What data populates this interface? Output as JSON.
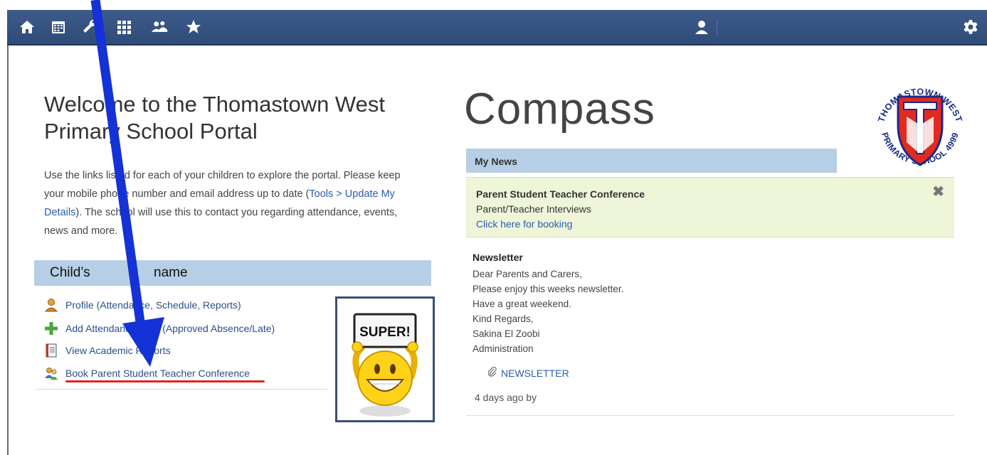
{
  "nav": {
    "icons": [
      "home-icon",
      "calendar-icon",
      "tools-icon",
      "grid-icon",
      "people-icon",
      "star-icon",
      "user-icon",
      "gear-icon"
    ]
  },
  "welcome": {
    "title": "Welcome to the Thomastown West Primary School Portal",
    "text_a": "Use the links listed for each of your children to explore the portal. Please keep your mobile phone number and email address up to date (",
    "text_link": "Tools > Update My Details",
    "text_b": "). The school will use this to contact you regarding attendance, events, news and more."
  },
  "child": {
    "header_left": "Child’s",
    "header_right": "name",
    "links": [
      {
        "label": "Profile (Attendance, Schedule, Reports)",
        "icon": "profile-icon"
      },
      {
        "label": "Add Attendance Note (Approved Absence/Late)",
        "icon": "plus-icon"
      },
      {
        "label": "View Academic Reports",
        "icon": "report-icon"
      },
      {
        "label": "Book Parent Student Teacher Conference",
        "icon": "conference-icon"
      }
    ]
  },
  "super": {
    "sign": "SUPER!"
  },
  "compass": {
    "title": "Compass"
  },
  "logo": {
    "top_text": "THOMASTOWN WEST",
    "bottom_text": "PRIMARY SCHOOL 4999"
  },
  "news": {
    "header": "My News",
    "conference": {
      "title": "Parent Student Teacher Conference",
      "subtitle": "Parent/Teacher Interviews",
      "link": "Click here for booking",
      "close": "✖"
    },
    "newsletter": {
      "title": "Newsletter",
      "lines": [
        "Dear Parents and Carers,",
        "Please enjoy this weeks newsletter.",
        "Have a great weekend.",
        "Kind Regards,",
        "Sakina El Zoobi",
        "Administration"
      ],
      "attachment": "NEWSLETTER",
      "meta": "4 days ago by"
    }
  },
  "colors": {
    "nav_bg": "#2f4b78",
    "header_bg": "#b6cfe6",
    "conf_bg": "#eef5d8",
    "link": "#2a5db0",
    "arrow": "#1432d6",
    "underline": "#e0241c"
  }
}
